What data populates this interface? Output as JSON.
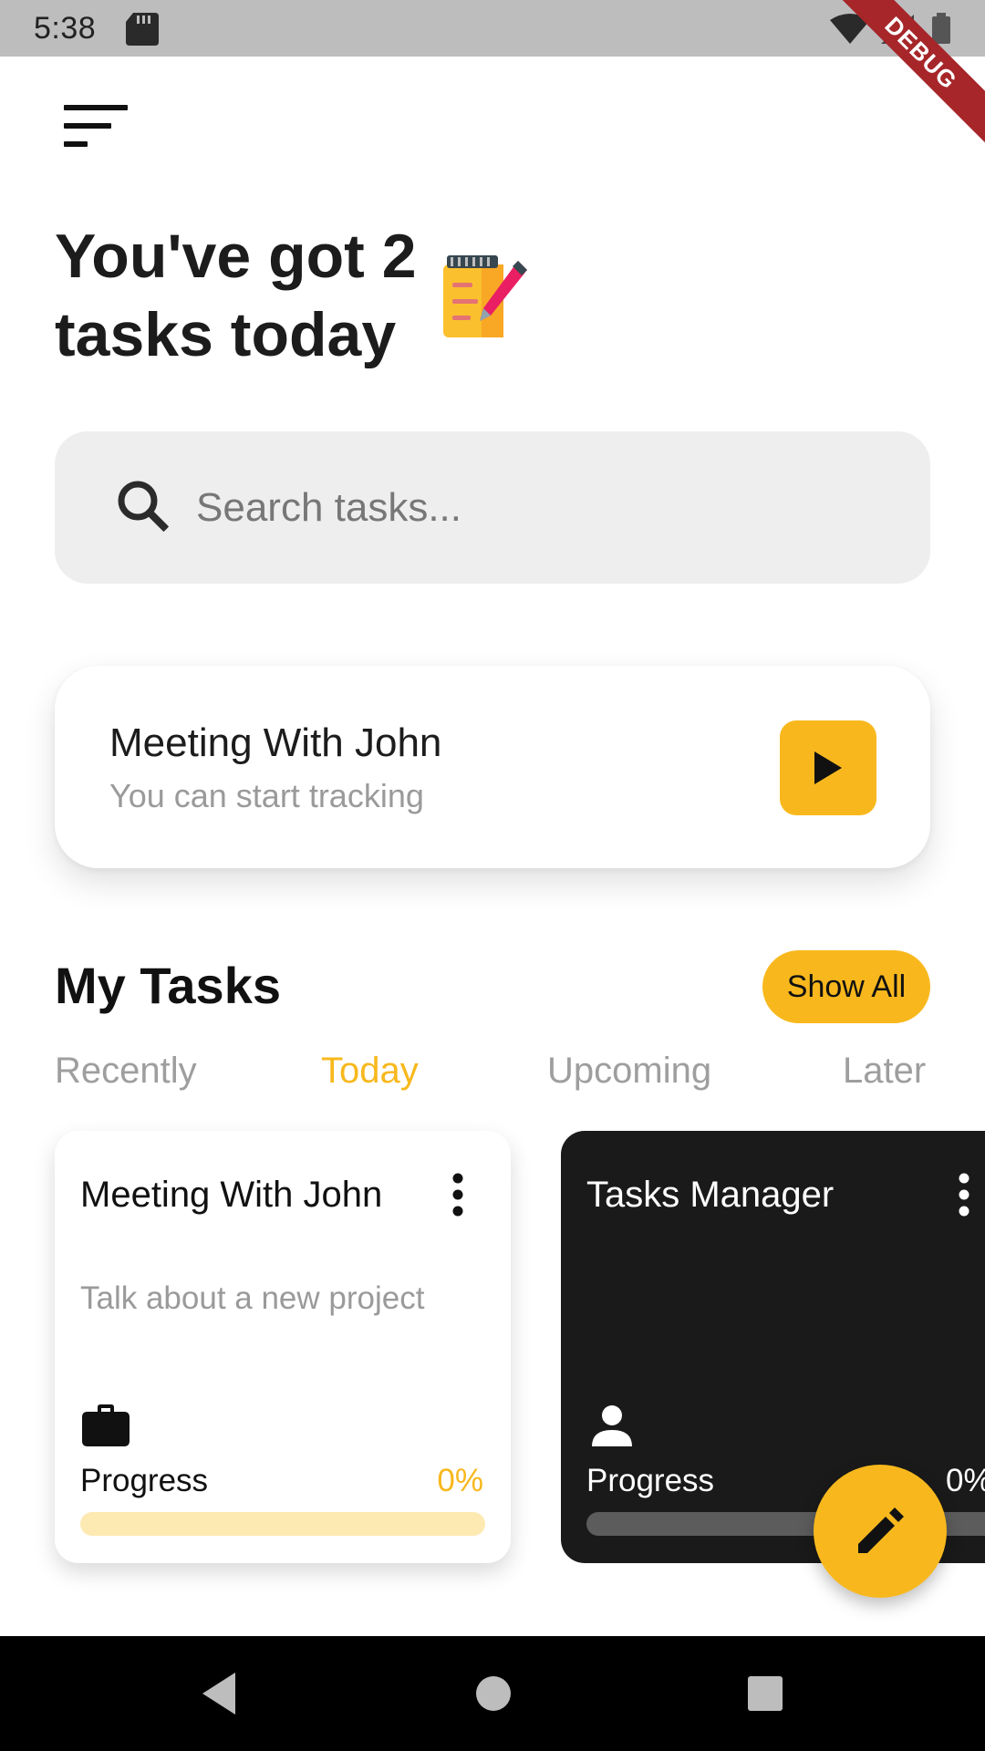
{
  "status_bar": {
    "time": "5:38",
    "debug_label": "DEBUG"
  },
  "header": {
    "menu_icon": "sort-menu-icon",
    "headline": "You've got 2 tasks today",
    "headline_icon": "notepad-pen-icon"
  },
  "search": {
    "placeholder": "Search tasks...",
    "value": "",
    "icon": "search-icon"
  },
  "tracking_card": {
    "title": "Meeting With John",
    "subtitle": "You can start tracking",
    "button_icon": "play-icon"
  },
  "my_tasks": {
    "title": "My Tasks",
    "show_all_label": "Show All",
    "tabs": [
      {
        "label": "Recently",
        "active": false
      },
      {
        "label": "Today",
        "active": true
      },
      {
        "label": "Upcoming",
        "active": false
      },
      {
        "label": "Later",
        "active": false
      }
    ],
    "cards": [
      {
        "title": "Meeting With John",
        "description": "Talk about a new project",
        "category_icon": "briefcase-icon",
        "progress_label": "Progress",
        "progress_value": "0%",
        "progress": 0
      },
      {
        "title": "Tasks Manager",
        "description": "",
        "category_icon": "person-icon",
        "progress_label": "Progress",
        "progress_value": "0%",
        "progress": 0
      }
    ]
  },
  "fab": {
    "icon": "pencil-icon"
  },
  "nav_bar": {
    "icons": [
      "back-icon",
      "home-icon",
      "recents-icon"
    ]
  },
  "colors": {
    "accent": "#F8B81D",
    "accent_light": "#FDE9B2",
    "dark_card": "#1A1A1A",
    "muted_text": "#9E9E9E",
    "search_bg": "#EEEEEE"
  }
}
